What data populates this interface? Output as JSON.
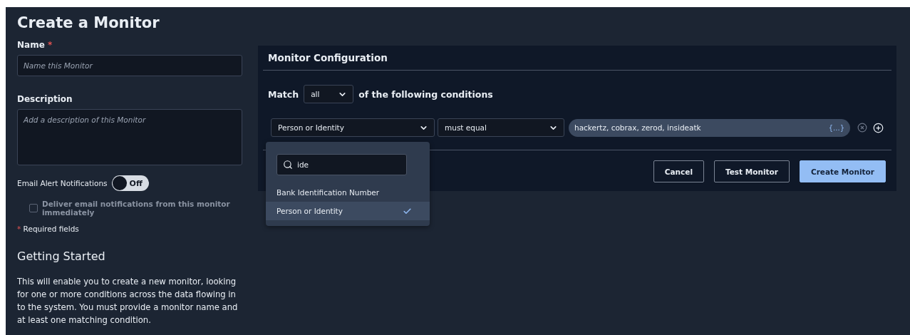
{
  "page_title": "Create a Monitor",
  "form": {
    "name": {
      "label": "Name",
      "required_mark": "*",
      "placeholder": "Name this Monitor"
    },
    "description": {
      "label": "Description",
      "placeholder": "Add a description of this Monitor"
    },
    "email_alerts": {
      "label": "Email Alert Notifications",
      "on": false,
      "state_text": "Off"
    },
    "deliver_immediately": {
      "label": "Deliver email notifications from this monitor immediately",
      "checked": false,
      "disabled": true
    },
    "required_note": {
      "mark": "*",
      "text": "Required fields"
    }
  },
  "getting_started": {
    "heading": "Getting Started",
    "text": "This will enable you to create a new monitor, looking for one or more conditions across the data flowing in to the system. You must provide a monitor name and at least one matching condition."
  },
  "config": {
    "title": "Monitor Configuration",
    "match_label": "Match",
    "match_value": "all",
    "match_suffix": "of the following conditions",
    "conditions": [
      {
        "field": "Person or Identity",
        "operator": "must equal",
        "value": "hackertz, cobrax, zerod, insideatk",
        "value_hint": "{...}"
      }
    ],
    "dropdown": {
      "search": "ide",
      "options": [
        {
          "label": "Bank Identification Number",
          "selected": false
        },
        {
          "label": "Person or Identity",
          "selected": true
        }
      ]
    },
    "buttons": [
      {
        "label": "Cancel",
        "kind": "outline"
      },
      {
        "label": "Test Monitor",
        "kind": "outline"
      },
      {
        "label": "Create Monitor",
        "kind": "primary"
      }
    ]
  }
}
